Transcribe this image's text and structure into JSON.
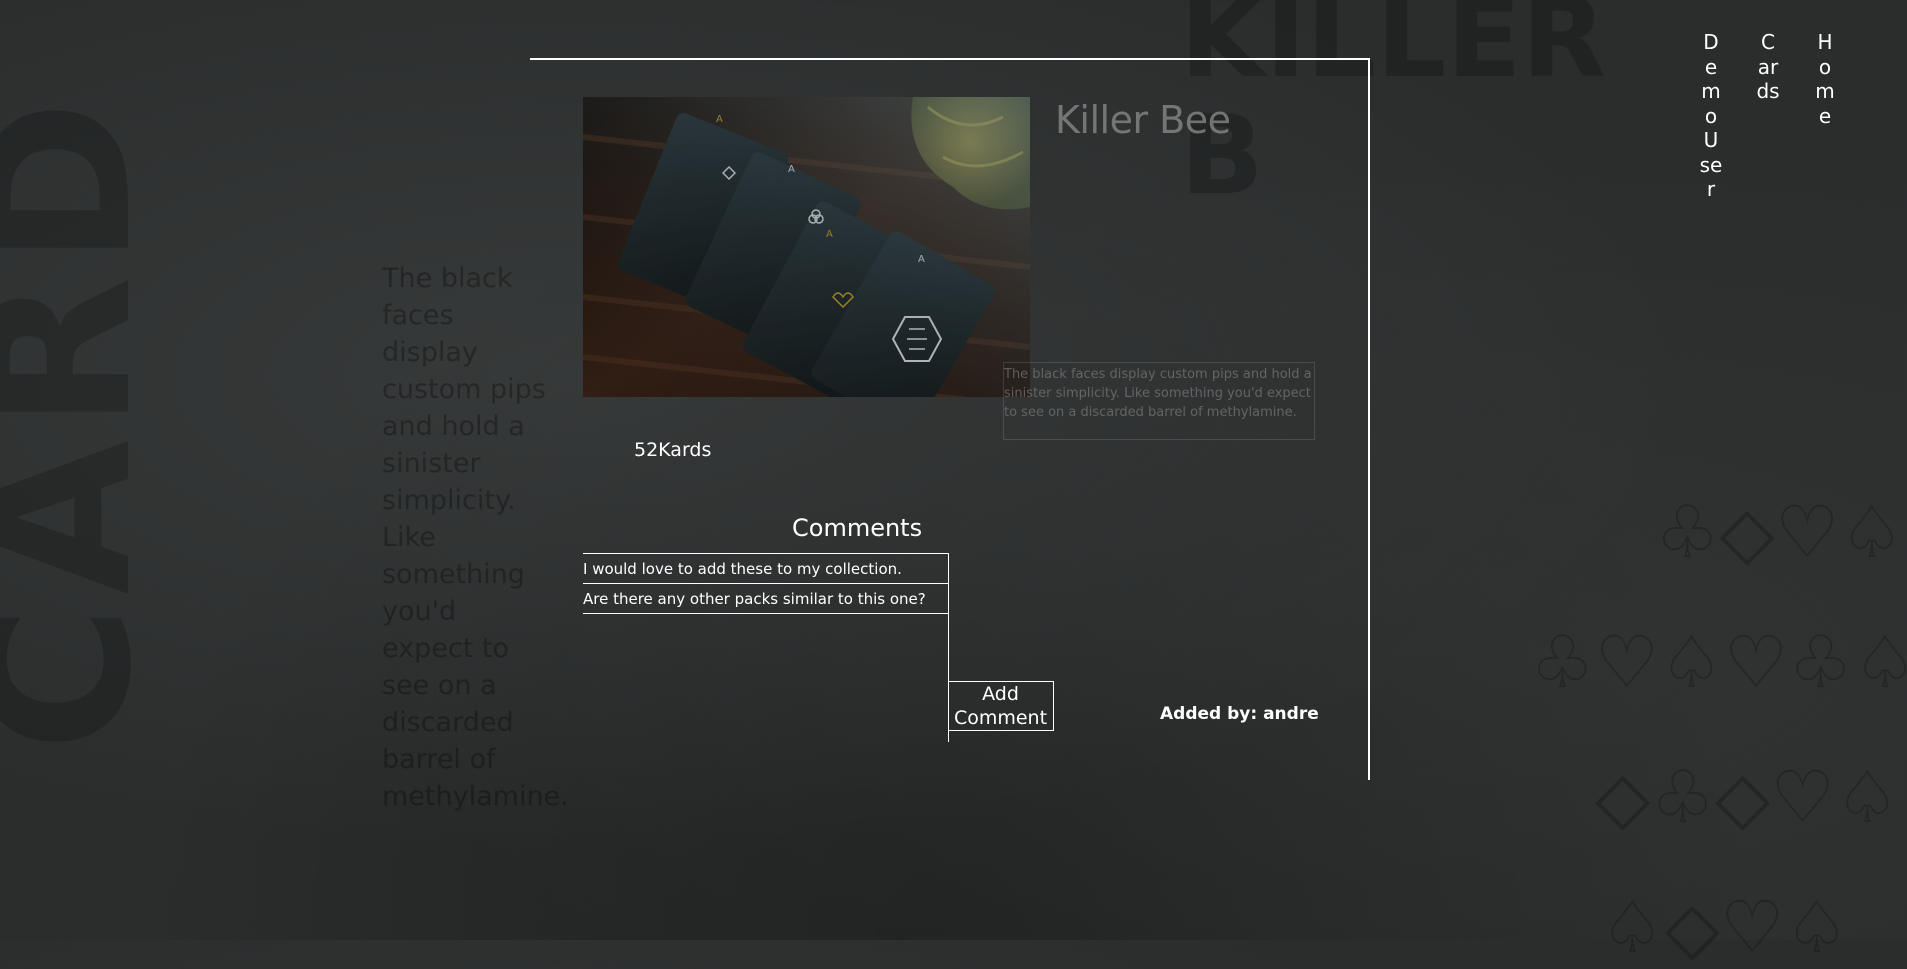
{
  "nav": {
    "user_label": "DemoUser",
    "cards_label": "Cards",
    "home_label": "Home"
  },
  "background": {
    "card_word": "CARD",
    "killer_word": "KILLER B",
    "suits_rows": [
      "♧◇♡♤",
      "♧♡♤♡♧♤",
      "◇♧◇♡♤",
      "♤◇♡♤"
    ]
  },
  "product": {
    "image_alt": "Killer Bee playing cards spread on a dark wooden table",
    "title": "Killer Bee",
    "description": "The black faces display custom pips and hold a sinister simplicity. Like something you'd expect to see on a discarded barrel of methylamine.",
    "brand": "52Kards",
    "added_by": "Added by: andre"
  },
  "comments": {
    "heading": "Comments",
    "items": [
      "I would love to add these to my collection.",
      "Are there any other packs similar to this one?"
    ],
    "add_label": "Add Comment"
  },
  "colors": {
    "background": "#2b2d2d",
    "foreground": "#ffffff",
    "accent_gold": "#c9a227"
  }
}
